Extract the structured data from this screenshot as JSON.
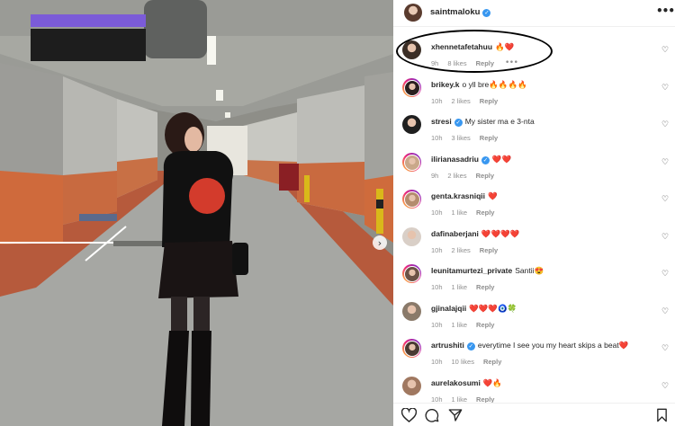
{
  "post": {
    "author": "saintmaloku",
    "verified": true
  },
  "comments": [
    {
      "user": "xhennetafetahuu",
      "verified": false,
      "text": "🔥❤️",
      "time": "9h",
      "likes": "8 likes",
      "reply": "Reply",
      "ring": false,
      "avatar": "#3b2e26"
    },
    {
      "user": "brikey.k",
      "verified": false,
      "text": "o yll bre🔥🔥🔥🔥",
      "time": "10h",
      "likes": "2 likes",
      "reply": "Reply",
      "ring": true,
      "avatar": "#2a2020"
    },
    {
      "user": "stresi",
      "verified": true,
      "text": "My sister ma e 3-nta",
      "time": "10h",
      "likes": "3 likes",
      "reply": "Reply",
      "ring": false,
      "avatar": "#1f1f1f"
    },
    {
      "user": "ilirianasadriu",
      "verified": true,
      "text": "❤️❤️",
      "time": "9h",
      "likes": "2 likes",
      "reply": "Reply",
      "ring": true,
      "avatar": "#c9a88a"
    },
    {
      "user": "genta.krasniqii",
      "verified": false,
      "text": "❤️",
      "time": "10h",
      "likes": "1 like",
      "reply": "Reply",
      "ring": true,
      "avatar": "#b48c6e"
    },
    {
      "user": "dafinaberjani",
      "verified": false,
      "text": "❤️❤️❤️❤️",
      "time": "10h",
      "likes": "2 likes",
      "reply": "Reply",
      "ring": false,
      "avatar": "#d9cfc7"
    },
    {
      "user": "leunitamurtezi_private",
      "verified": false,
      "text": "Santii😍",
      "time": "10h",
      "likes": "1 like",
      "reply": "Reply",
      "ring": true,
      "avatar": "#6b5246"
    },
    {
      "user": "gjinalajqii",
      "verified": false,
      "text": "❤️❤️❤️🧿🍀",
      "time": "10h",
      "likes": "1 like",
      "reply": "Reply",
      "ring": false,
      "avatar": "#8a7a6a"
    },
    {
      "user": "artrushiti",
      "verified": true,
      "text": "everytime I see you my heart skips a beat❤️",
      "time": "10h",
      "likes": "10 likes",
      "reply": "Reply",
      "ring": true,
      "avatar": "#4a3a33"
    },
    {
      "user": "aurelakosumi",
      "verified": false,
      "text": "❤️🔥",
      "time": "10h",
      "likes": "1 like",
      "reply": "Reply",
      "ring": false,
      "avatar": "#a07860"
    }
  ],
  "colors": {
    "accent_verified": "#3897f0",
    "muted_text": "#8e8e8e",
    "primary_text": "#262626"
  },
  "icons": {
    "more": "more-options-icon",
    "heart": "heart-icon",
    "comment": "comment-icon",
    "share": "share-icon",
    "save": "bookmark-icon",
    "next": "chevron-right-icon"
  }
}
